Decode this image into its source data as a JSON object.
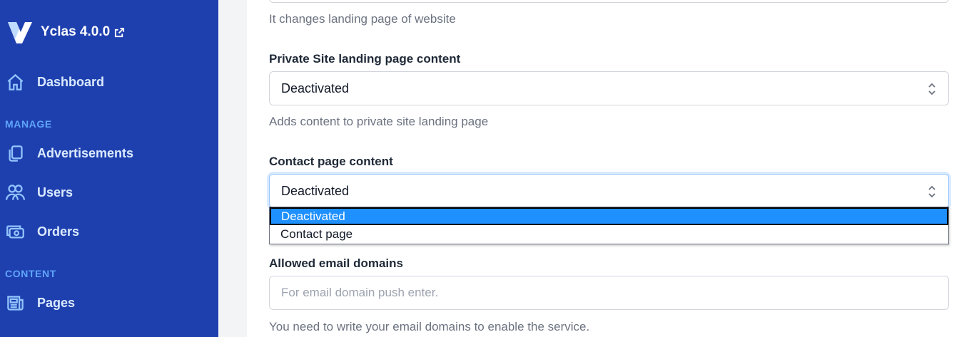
{
  "sidebar": {
    "brand": {
      "name": "Yclas 4.0.0",
      "logo_icon": "yclas-logo-icon",
      "external_icon": "external-link-icon"
    },
    "dashboard": {
      "label": "Dashboard",
      "icon": "home-icon"
    },
    "sections": {
      "manage": "MANAGE",
      "content": "CONTENT"
    },
    "items": [
      {
        "label": "Advertisements",
        "icon": "duplicate-icon"
      },
      {
        "label": "Users",
        "icon": "users-icon"
      },
      {
        "label": "Orders",
        "icon": "cash-icon"
      },
      {
        "label": "Pages",
        "icon": "newspaper-icon"
      }
    ]
  },
  "form": {
    "landing_help": "It changes landing page of website",
    "private_site": {
      "label": "Private Site landing page content",
      "value": "Deactivated",
      "help": "Adds content to private site landing page"
    },
    "contact_page": {
      "label": "Contact page content",
      "value": "Deactivated",
      "options": [
        "Deactivated",
        "Contact page"
      ],
      "selected_index": 0
    },
    "email_domains": {
      "label": "Allowed email domains",
      "placeholder": "For email domain push enter.",
      "help": "You need to write your email domains to enable the service."
    }
  },
  "colors": {
    "sidebar_bg": "#1e40af",
    "option_highlight": "#1e90ff",
    "section_title": "#60a5fa"
  }
}
